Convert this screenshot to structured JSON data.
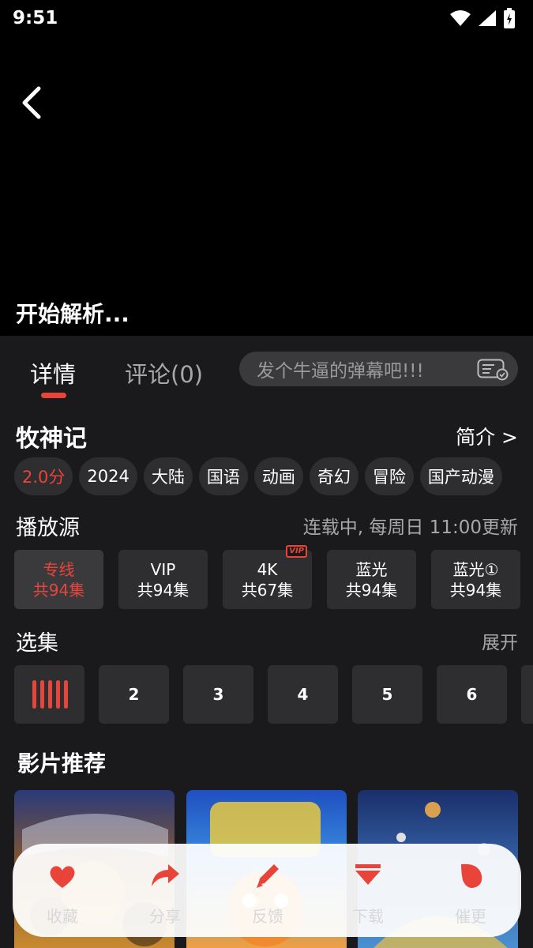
{
  "status_bar": {
    "time": "9:51"
  },
  "player": {
    "status_text": "开始解析..."
  },
  "tabs": [
    {
      "label": "详情"
    },
    {
      "label": "评论(0)"
    }
  ],
  "danmaku": {
    "placeholder": "发个牛逼的弹幕吧!!!"
  },
  "show": {
    "title": "牧神记",
    "intro_link": "简介 >",
    "tags": [
      "2.0分",
      "2024",
      "大陆",
      "国语",
      "动画",
      "奇幻",
      "冒险",
      "国产动漫"
    ]
  },
  "sources": {
    "title": "播放源",
    "status": "连载中, 每周日 11:00更新",
    "items": [
      {
        "name": "专线",
        "count": "共94集"
      },
      {
        "name": "VIP",
        "count": "共94集"
      },
      {
        "name": "4K",
        "count": "共67集",
        "badge": "VIP"
      },
      {
        "name": "蓝光",
        "count": "共94集"
      },
      {
        "name": "蓝光①",
        "count": "共94集"
      }
    ]
  },
  "episodes": {
    "title": "选集",
    "expand": "展开",
    "items": [
      "2",
      "3",
      "4",
      "5",
      "6"
    ]
  },
  "recommendations": {
    "title": "影片推荐"
  },
  "actions": [
    {
      "label": "收藏",
      "icon": "heart-icon"
    },
    {
      "label": "分享",
      "icon": "share-icon"
    },
    {
      "label": "反馈",
      "icon": "pencil-icon"
    },
    {
      "label": "下载",
      "icon": "download-icon"
    },
    {
      "label": "催更",
      "icon": "flame-icon"
    }
  ],
  "colors": {
    "accent": "#e8443a",
    "background": "#1a1a1c",
    "card": "#2e2e31"
  }
}
